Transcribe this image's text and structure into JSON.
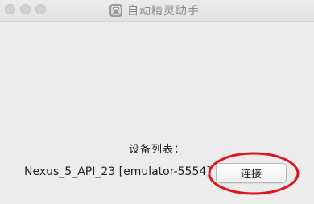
{
  "window": {
    "title": "自动精灵助手"
  },
  "main": {
    "device_list_label": "设备列表：",
    "devices": [
      {
        "name": "Nexus_5_API_23 [emulator-5554]"
      }
    ],
    "connect_label": "连接"
  },
  "colors": {
    "highlight": "#e0141e",
    "window_bg": "#ececec"
  }
}
